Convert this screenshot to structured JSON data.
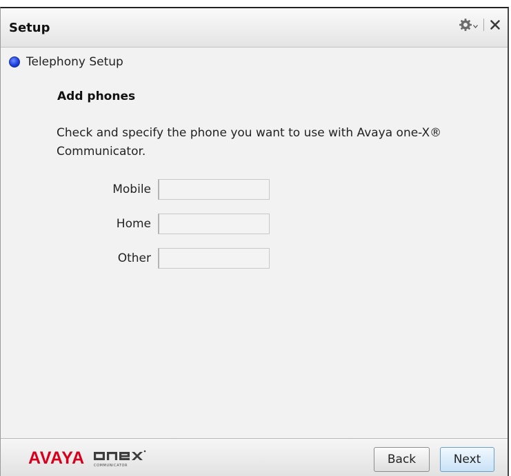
{
  "window": {
    "title": "Setup"
  },
  "section": {
    "label": "Telephony Setup"
  },
  "heading": "Add phones",
  "description": "Check and specify the phone you want to use with Avaya one-X® Communicator.",
  "fields": [
    {
      "label": "Mobile",
      "value": "",
      "placeholder": ""
    },
    {
      "label": "Home",
      "value": "",
      "placeholder": ""
    },
    {
      "label": "Other",
      "value": "",
      "placeholder": ""
    }
  ],
  "footer": {
    "logo": {
      "brand": "AVAYA",
      "product": "onex",
      "product_subtitle": "COMMUNICATOR"
    },
    "back_label": "Back",
    "next_label": "Next"
  },
  "colors": {
    "brand_red": "#d6001c",
    "radio_blue": "#1b3fe0",
    "next_accent": "#6a9ec6"
  },
  "icons": [
    "gear-icon",
    "chevron-down-icon",
    "close-icon"
  ]
}
